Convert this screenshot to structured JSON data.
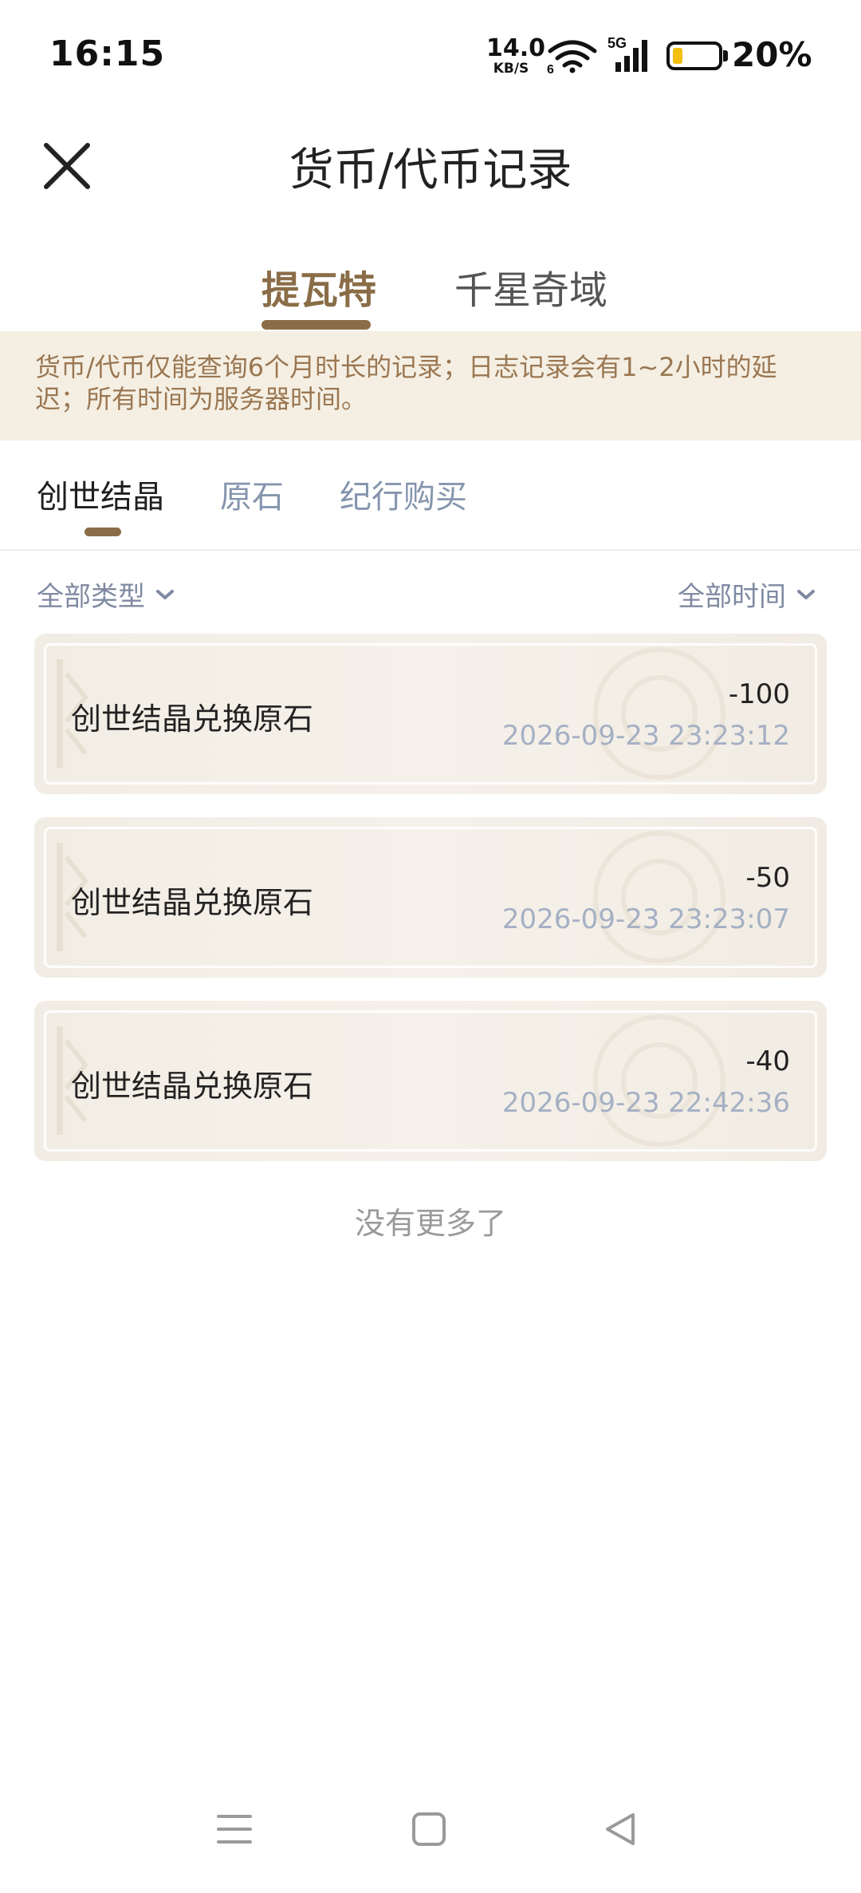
{
  "status_bar": {
    "time": "16:15",
    "net_speed_value": "14.0",
    "net_speed_unit": "KB/S",
    "wifi_badge": "6",
    "signal_badge": "5G",
    "battery_percent": "20%",
    "battery_level": 0.2,
    "icons": [
      "wifi-icon",
      "signal-icon",
      "battery-icon"
    ]
  },
  "header": {
    "title": "货币/代币记录",
    "close_icon": "close-icon"
  },
  "top_tabs": [
    {
      "label": "提瓦特",
      "active": true
    },
    {
      "label": "千星奇域",
      "active": false
    }
  ],
  "notice": "货币/代币仅能查询6个月时长的记录；日志记录会有1~2小时的延迟；所有时间为服务器时间。",
  "currency_tabs": [
    {
      "label": "创世结晶",
      "active": true
    },
    {
      "label": "原石",
      "active": false
    },
    {
      "label": "纪行购买",
      "active": false
    }
  ],
  "filters": {
    "type": "全部类型",
    "time": "全部时间"
  },
  "records": [
    {
      "title": "创世结晶兑换原石",
      "amount": "-100",
      "time": "2026-09-23 23:23:12"
    },
    {
      "title": "创世结晶兑换原石",
      "amount": "-50",
      "time": "2026-09-23 23:23:07"
    },
    {
      "title": "创世结晶兑换原石",
      "amount": "-40",
      "time": "2026-09-23 22:42:36"
    }
  ],
  "no_more": "没有更多了",
  "nav_bar": [
    "menu-icon",
    "home-icon",
    "back-icon"
  ],
  "colors": {
    "accent": "#8a6d48",
    "notice_bg": "#f5efe3",
    "notice_text": "#9a7752",
    "inactive_tab": "#8595ad",
    "timestamp": "#a5b0c4"
  }
}
